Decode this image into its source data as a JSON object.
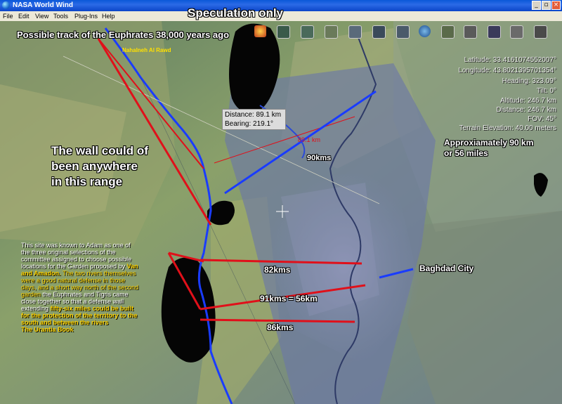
{
  "window": {
    "title": "NASA World Wind",
    "min": "_",
    "max": "▫",
    "close": "×"
  },
  "menu": [
    "File",
    "Edit",
    "View",
    "Tools",
    "Plug-Ins",
    "Help"
  ],
  "overlay_title": "Speculation only",
  "track_label": "Possible track of the Euphrates 38,000 years ago",
  "place_label": "Nahalneh Al Rawd",
  "wall_label": "The wall could of been anywhere in this range",
  "approx_label": "Approxiamately 90 km or 56 miles",
  "measure": {
    "distance": "Distance: 89.1 km",
    "bearing": "Bearing: 219.1°",
    "line_label": "89.1 km",
    "kms90": "90kms"
  },
  "coords": {
    "latitude": "Latitude: 33.4161074552007°",
    "longitude": "Longitude: 43.8021395701354°",
    "heading": "Heading: 323.09°",
    "tilt": "Tilt: 0°",
    "altitude": "Altitude: 246.7 km",
    "distance": "Distance: 246.7 km",
    "fov": "FOV: 45°",
    "elevation": "Terrain Elevation: 40.00 meters"
  },
  "city_label": "Baghdad City",
  "dist_lines": [
    "82kms",
    "91kms = 56km",
    "86kms"
  ],
  "quote": {
    "part1": "This site was known to Adam as one of the three original selections of the committee assigned to choose possible locations for the Garden proposed by ",
    "names": "Van and Amadon.",
    "part2": " The two rivers themselves were a good natural defense in those days, and a short way north of the second garden",
    "part3": " the Euphrates and Tigris came close together so that a defense wall extending ",
    "part4": "fifty-six miles could be built for the protection of the territory to the south and between the rivers",
    "source": "The Urantia Book"
  },
  "colors": {
    "red_line": "#e0101a",
    "blue_line": "#1a3cff",
    "title_bar": "#0a58d8",
    "quote_yellow": "#ffd400"
  }
}
